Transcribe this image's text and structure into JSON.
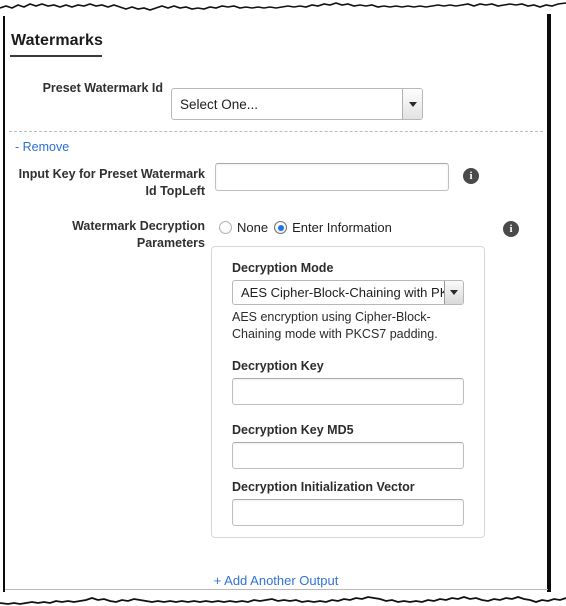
{
  "section": {
    "heading": "Watermarks"
  },
  "preset_row": {
    "label": "Preset Watermark Id",
    "select_value": "Select One...",
    "arrow_icon": "chevron-down-icon"
  },
  "remove_link": {
    "label": "- Remove"
  },
  "input_key_row": {
    "label": "Input Key for Preset Watermark Id TopLeft",
    "value": "",
    "placeholder": "",
    "info_icon": "info-icon"
  },
  "watermark_decryption": {
    "label": "Watermark Decryption Parameters",
    "info_icon": "info-icon",
    "options": [
      {
        "label": "None",
        "selected": false
      },
      {
        "label": "Enter Information",
        "selected": true
      }
    ]
  },
  "decryption_panel": {
    "mode_label": "Decryption Mode",
    "mode_value": "AES Cipher-Block-Chaining with PKCS",
    "mode_help": "AES encryption using Cipher-Block-Chaining mode with PKCS7 padding.",
    "key_label": "Decryption Key",
    "key_value": "",
    "key_md5_label": "Decryption Key MD5",
    "key_md5_value": "",
    "iv_label": "Decryption Initialization Vector",
    "iv_value": ""
  },
  "add_output_link": {
    "label": "+ Add Another Output"
  },
  "colors": {
    "link": "#2b6fd4",
    "accent_radio": "#1a73e8",
    "info_badge": "#4a4a4a",
    "heading": "#1b1b1b",
    "panel_border": "#d7d7d7"
  }
}
